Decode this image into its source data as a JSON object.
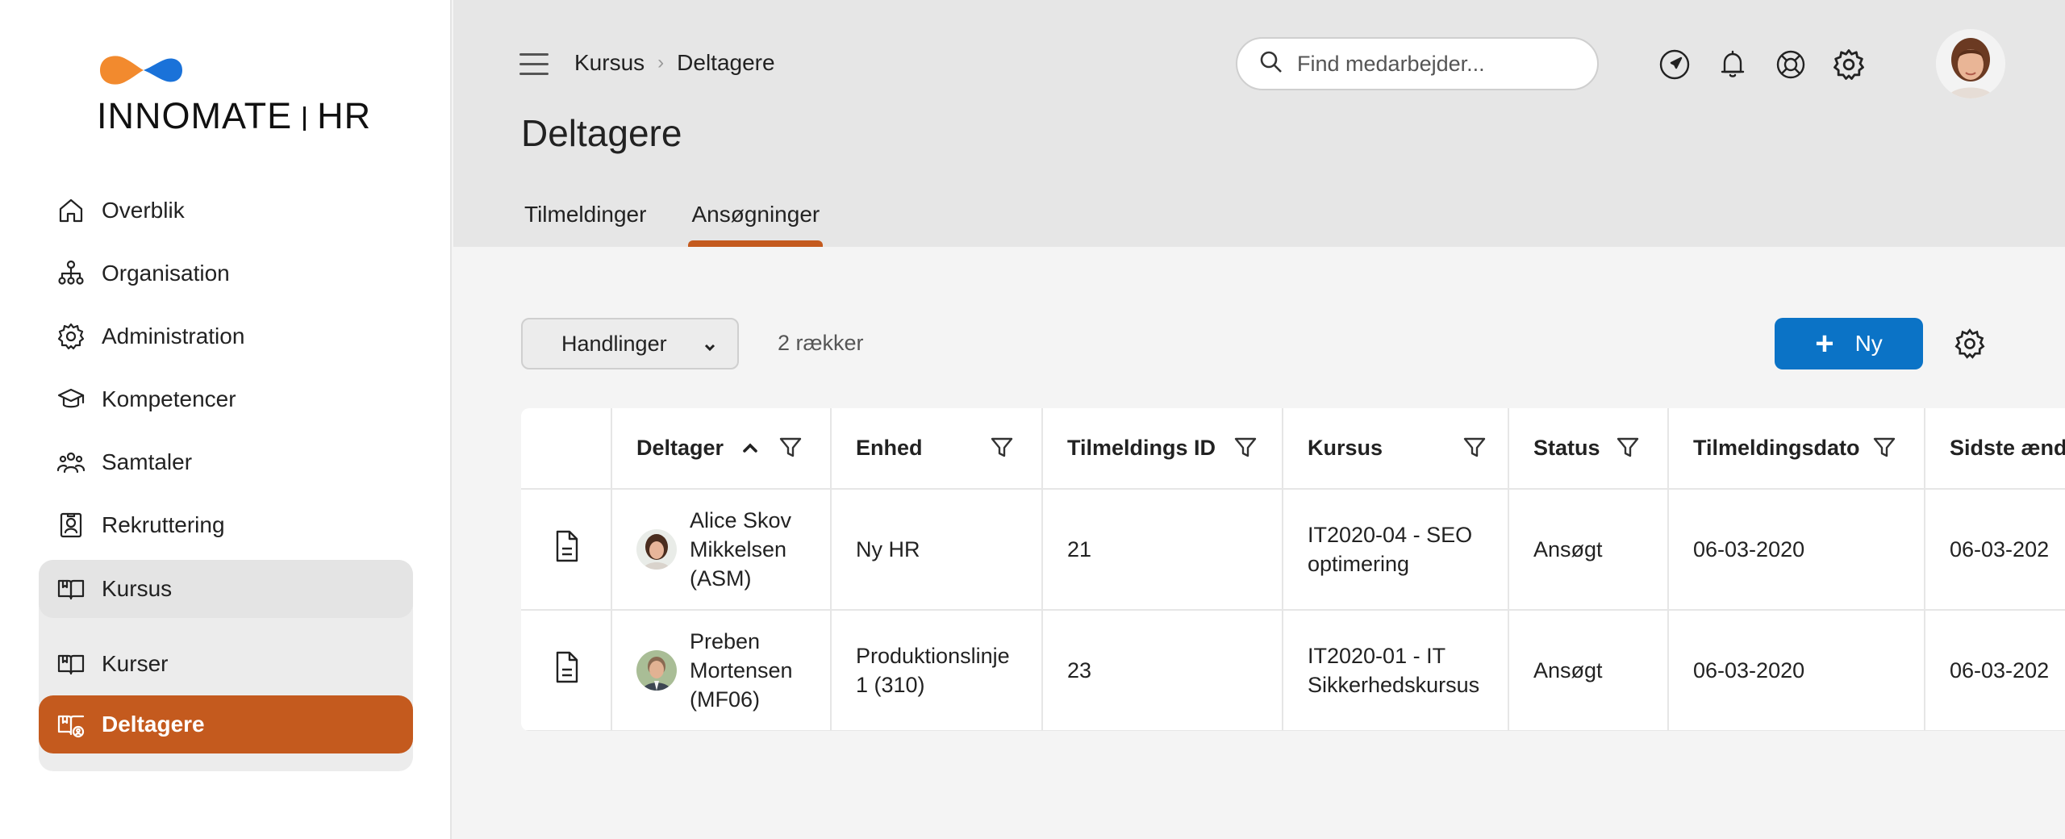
{
  "brand": {
    "name_light": "INNO",
    "name_bold": "MATE",
    "suffix": "HR",
    "accent_orange": "#f28a2e",
    "accent_blue": "#1a72d9"
  },
  "sidebar": {
    "items": [
      {
        "label": "Overblik",
        "icon": "home-icon"
      },
      {
        "label": "Organisation",
        "icon": "org-chart-icon"
      },
      {
        "label": "Administration",
        "icon": "gear-icon"
      },
      {
        "label": "Kompetencer",
        "icon": "graduation-cap-icon"
      },
      {
        "label": "Samtaler",
        "icon": "people-icon"
      },
      {
        "label": "Rekruttering",
        "icon": "id-badge-icon"
      }
    ],
    "group": {
      "label": "Kursus",
      "icon": "book-icon",
      "children": [
        {
          "label": "Kurser",
          "icon": "book-icon"
        },
        {
          "label": "Deltagere",
          "icon": "book-user-icon",
          "active": true
        }
      ]
    },
    "active_color": "#c45a1e"
  },
  "header": {
    "breadcrumb": [
      "Kursus",
      "Deltagere"
    ],
    "search_placeholder": "Find medarbejder...",
    "icons": [
      "navigate-icon",
      "bell-icon",
      "lifebuoy-icon",
      "gear-icon"
    ],
    "title": "Deltagere",
    "tabs": [
      {
        "label": "Tilmeldinger",
        "active": false
      },
      {
        "label": "Ansøgninger",
        "active": true
      }
    ]
  },
  "toolbar": {
    "actions_label": "Handlinger",
    "row_count": "2 rækker",
    "new_label": "Ny",
    "new_color": "#0b73c6"
  },
  "table": {
    "columns": [
      "Deltager",
      "Enhed",
      "Tilmeldings ID",
      "Kursus",
      "Status",
      "Tilmeldingsdato",
      "Sidste ænd"
    ],
    "sorted_column": "Deltager",
    "sort_direction": "ascending",
    "rows": [
      {
        "deltager_lines": [
          "Alice Skov",
          "Mikkelsen",
          "(ASM)"
        ],
        "enhed_lines": [
          "Ny HR"
        ],
        "id": "21",
        "kursus_lines": [
          "IT2020-04 - SEO",
          "optimering"
        ],
        "status": "Ansøgt",
        "dato": "06-03-2020",
        "sidste": "06-03-202"
      },
      {
        "deltager_lines": [
          "Preben",
          "Mortensen",
          "(MF06)"
        ],
        "enhed_lines": [
          "Produktionslinje",
          "1 (310)"
        ],
        "id": "23",
        "kursus_lines": [
          "IT2020-01 - IT",
          "Sikkerhedskursus"
        ],
        "status": "Ansøgt",
        "dato": "06-03-2020",
        "sidste": "06-03-202"
      }
    ]
  }
}
